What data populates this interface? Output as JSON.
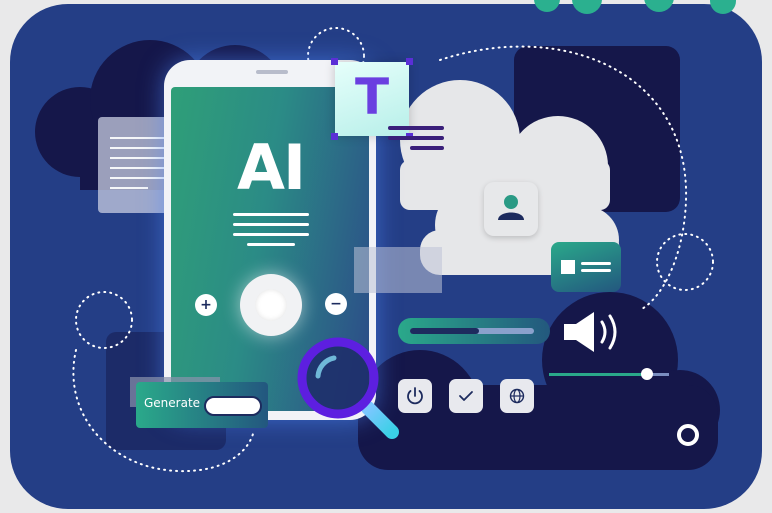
{
  "phone": {
    "headline": "AI",
    "zoom_in": "+",
    "zoom_out": "−"
  },
  "text_tool": {
    "letter": "T"
  },
  "generate": {
    "label": "Generate",
    "toggle_on": true
  },
  "audio": {
    "progress": 0.56,
    "volume": 0.82
  },
  "controls": {
    "power_icon": "power-icon",
    "check_icon": "check-icon",
    "globe_icon": "globe-icon"
  },
  "colors": {
    "panel": "#243e86",
    "teal": "#2aa98a",
    "purple": "#5b2fd6",
    "navy": "#15174a"
  }
}
